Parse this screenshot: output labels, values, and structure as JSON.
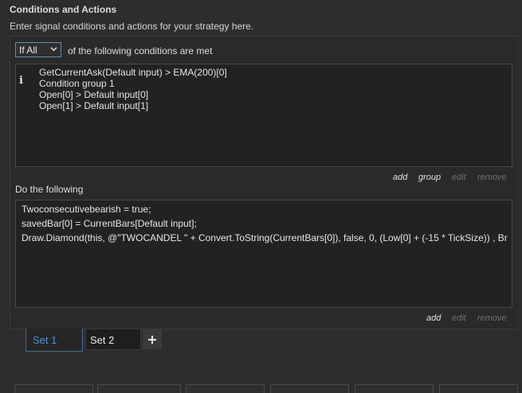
{
  "header": {
    "title": "Conditions and Actions",
    "subtitle": "Enter signal conditions and actions for your strategy here."
  },
  "conditions": {
    "mode_selected": "If All",
    "mode_label": "of the following conditions are met",
    "lines": [
      "GetCurrentAsk(Default input) > EMA(200)[0]",
      "Condition group 1",
      "Open[0] > Default input[0]",
      "Open[1] > Default input[1]"
    ],
    "actions": {
      "add": "add",
      "group": "group",
      "edit": "edit",
      "remove": "remove"
    }
  },
  "do_following": {
    "label": "Do the following",
    "lines": [
      "Twoconsecutivebearish = true;",
      "savedBar[0] = CurrentBars[Default input];",
      "Draw.Diamond(this, @\"TWOCANDEL \" + Convert.ToString(CurrentBars[0]), false, 0, (Low[0] + (-15 * TickSize)) , Br"
    ],
    "actions": {
      "add": "add",
      "edit": "edit",
      "remove": "remove"
    }
  },
  "sets": {
    "tabs": [
      "Set 1",
      "Set 2"
    ],
    "active_index": 0,
    "add_symbol": "+"
  },
  "colors": {
    "accent": "#4a90e2",
    "background": "#2d2d2d",
    "editor_bg": "#222222"
  },
  "icons": {
    "info": "info-icon",
    "dropdown": "chevron-down-icon",
    "add_set": "plus-icon"
  }
}
